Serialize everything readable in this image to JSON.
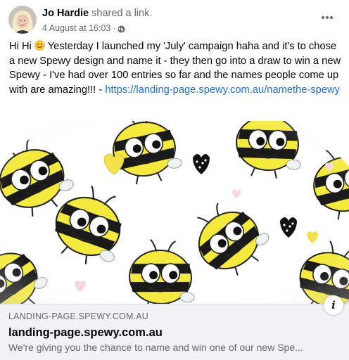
{
  "post": {
    "author": "Jo Hardie",
    "action": "shared a link.",
    "timestamp": "4 August at 16:03",
    "separator": "·",
    "privacy_icon": "globe-icon",
    "more_icon": "more-dots-icon",
    "text_start": "Hi Hi",
    "emoji": "smiling-face-emoji",
    "text_body": " Yesterday I launched my 'July' campaign haha and it's to chose a new Spewy design and name it - they then go into a draw to win a new Spewy - I've had over 100 entries so far and the names people come up with are amazing!!! - ",
    "link_text": "https://landing-page.spewy.com.au/namethe-spewy"
  },
  "link_preview": {
    "domain": "LANDING-PAGE.SPEWY.COM.AU",
    "title": "landing-page.spewy.com.au",
    "description": "We're giving you the chance to name and win one of our new Spe...",
    "info_icon": "info-icon",
    "info_label": "i",
    "image_name": "bee-pattern-image"
  },
  "colors": {
    "link": "#216fdb",
    "secondary_text": "#65676b",
    "preview_bg": "#f0f2f5",
    "bee_yellow": "#f4ea3c"
  }
}
